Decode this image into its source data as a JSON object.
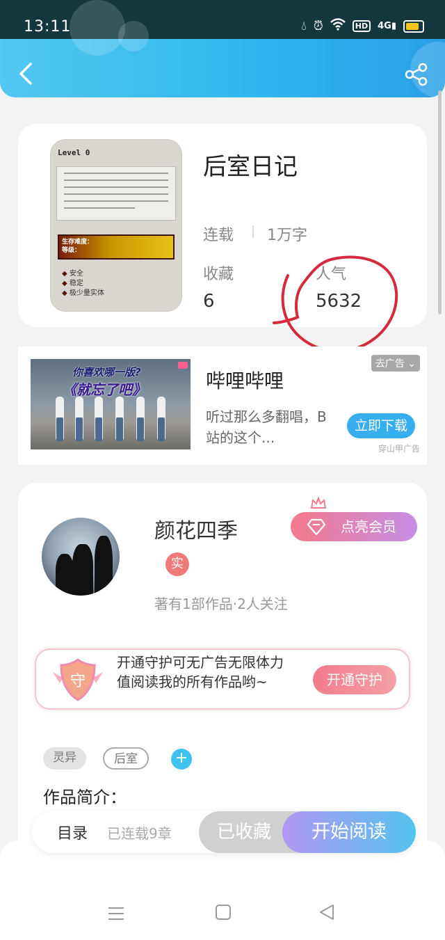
{
  "status_bar": {
    "time": "13:11",
    "network": "4G",
    "hd": "HD"
  },
  "book": {
    "title": "后室日记",
    "status": "连载",
    "word_count": "1万字",
    "favorites_label": "收藏",
    "favorites_value": "6",
    "popularity_label": "人气",
    "popularity_value": "5632",
    "cover": {
      "level_text": "Level 0",
      "bar_text_1": "生存难度：",
      "bar_text_2": "等级：",
      "features": [
        "安全",
        "稳定",
        "极少量实体"
      ]
    }
  },
  "ad": {
    "title": "哔哩哔哩",
    "description": "听过那么多翻唱，B站的这个...",
    "tag": "去广告",
    "button": "立即下载",
    "source": "穿山甲广告",
    "image_caption_1": "你喜欢哪一版?",
    "image_caption_2": "《就忘了吧》"
  },
  "author": {
    "name": "颜花四季",
    "badge": "实",
    "meta": "著有1部作品·2人关注",
    "vip_button": "点亮会员"
  },
  "guard": {
    "icon_text": "守",
    "text": "开通守护可无广告无限体力值阅读我的所有作品哟~",
    "button": "开通守护"
  },
  "tags": [
    "灵异",
    "后室"
  ],
  "tag_add": "+",
  "intro_title": "作品简介：",
  "action_bar": {
    "catalog": "目录",
    "catalog_sub": "已连载9章",
    "collected": "已收藏",
    "read": "开始阅读"
  }
}
